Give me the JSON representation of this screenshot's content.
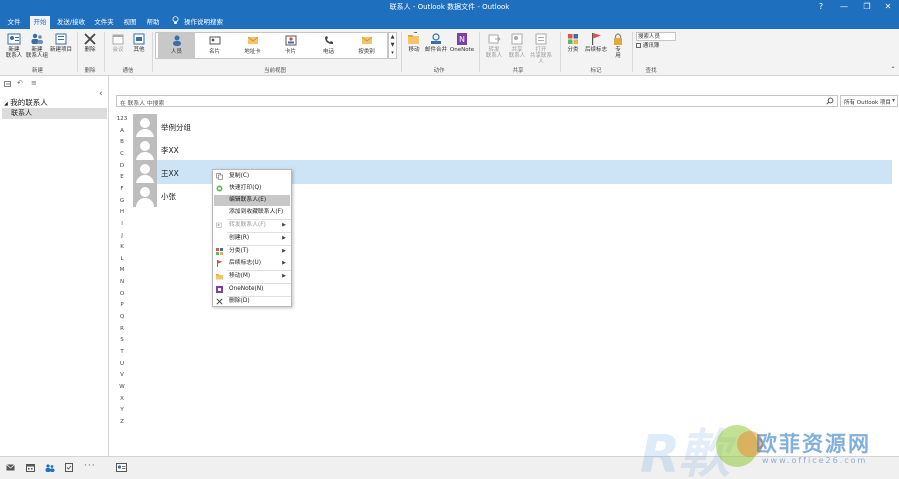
{
  "window": {
    "title": "联系人 - Outlook 数据文件 - Outlook",
    "controls": [
      "?",
      "—",
      "❐",
      "✕"
    ]
  },
  "tabs": [
    {
      "label": "文件"
    },
    {
      "label": "开始"
    },
    {
      "label": "发送/接收"
    },
    {
      "label": "文件夹"
    },
    {
      "label": "视图"
    },
    {
      "label": "帮助"
    },
    {
      "label": "操作说明搜索"
    }
  ],
  "ribbon": {
    "new_contact": "新建\n联系人",
    "new_contact_group": "新建\n联系人组",
    "new_items": "新建项目",
    "group_new": "新建",
    "delete": "删除",
    "group_delete": "删除",
    "meeting": "会议",
    "more": "其他",
    "group_comm": "通信",
    "views": [
      "人员",
      "名片",
      "地址卡",
      "卡片",
      "电话",
      "按类别"
    ],
    "group_view": "当前视图",
    "move": "移动",
    "mail_merge": "邮件合并",
    "onenote": "OneNote",
    "group_actions": "动作",
    "forward_contact": "转发\n联系人",
    "share_contacts": "共享\n联系人",
    "open_shared": "打开\n共享联系人",
    "group_share": "共享",
    "categorize": "分类",
    "followup": "后续标志",
    "private": "专\n用",
    "group_tags": "标记",
    "search_people": "搜索人员",
    "address_book": "通讯簿",
    "group_find": "查找"
  },
  "leftpane": {
    "header": "我的联系人",
    "folder": "联系人",
    "collapse": "‹"
  },
  "search": {
    "placeholder": "在 联系人 中搜索",
    "scope": "所有 Outlook 项目"
  },
  "letters": [
    "123",
    "A",
    "B",
    "C",
    "D",
    "E",
    "F",
    "G",
    "H",
    "I",
    "J",
    "K",
    "L",
    "M",
    "N",
    "O",
    "P",
    "Q",
    "R",
    "S",
    "T",
    "U",
    "V",
    "W",
    "X",
    "Y",
    "Z"
  ],
  "contacts": [
    {
      "name": "举例分组"
    },
    {
      "name": "李XX"
    },
    {
      "name": "王XX"
    },
    {
      "name": "小张"
    }
  ],
  "context_menu": [
    {
      "label": "复制(C)"
    },
    {
      "label": "快速打印(Q)"
    },
    {
      "label": "编辑联系人(E)"
    },
    {
      "label": "添加到收藏联系人(F)"
    },
    {
      "label": "转发联系人(F)"
    },
    {
      "label": "创建(R)"
    },
    {
      "label": "分类(T)"
    },
    {
      "label": "后续标志(U)"
    },
    {
      "label": "移动(M)"
    },
    {
      "label": "OneNote(N)"
    },
    {
      "label": "删除(D)"
    }
  ],
  "watermark": {
    "brand": "欧菲资源网",
    "url": "www.office26.com"
  },
  "colors": {
    "accent": "#1e6fbe",
    "selected_row": "#cde4f7",
    "menu_highlight": "#c8c8c8"
  }
}
